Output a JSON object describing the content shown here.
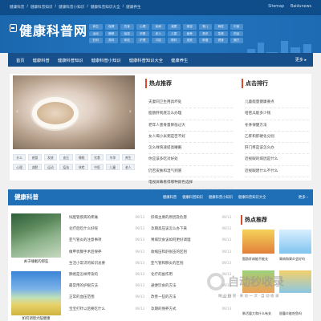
{
  "topbar": {
    "crumbs": [
      "健康科普",
      "健康科普知识",
      "健康科普小知识",
      "健康科普知识大全",
      "健康养生"
    ],
    "links": [
      "Sitemap",
      "Baidunews"
    ]
  },
  "site": {
    "logo_text": "健康科普网",
    "tags": [
      "养生",
      "保健",
      "饮食",
      "心理",
      "疾病",
      "减肥",
      "美容",
      "育儿",
      "两性",
      "中医",
      "运动",
      "睡眠",
      "疫苗",
      "孕婴",
      "老人",
      "儿童",
      "营养",
      "常识",
      "急救",
      "药品",
      "妇科",
      "男科",
      "体检",
      "护理",
      "口腔",
      "眼科",
      "皮肤",
      "肿瘤",
      "健身",
      "偏方"
    ]
  },
  "nav": {
    "items": [
      "首页",
      "健康科普",
      "健康科普知识",
      "健康科普小知识",
      "健康科普知识大全",
      "健康养生"
    ],
    "more": "更多 ▸"
  },
  "featured": {
    "tags": [
      "什么",
      "感冒",
      "发烧",
      "血压",
      "睡眠",
      "饮食",
      "冬季",
      "养生",
      "心理",
      "减肥",
      "运动",
      "疫苗",
      "体检",
      "中医",
      "儿童",
      "老人"
    ]
  },
  "hot": {
    "title": "热点推荐",
    "items": [
      "夫妻同卫生用具坏处",
      "脂肪肝到底怎么办理",
      "老年人患骨量降低过大",
      "女人喝小米粥是否不好",
      "怎么样快速提高睡眠",
      "你应该多吃对好处",
      "仍否皮肤和湿气到底",
      "电视屏幕看得哪种颜色选择"
    ]
  },
  "rank": {
    "title": "点击排行",
    "items": [
      "儿童能量健康要点",
      "哈密瓜能多少钱",
      "冬季保健方法",
      "乙肝和肝硬化分别",
      "肝门疼是该怎么办",
      "近视眼的病因是什么",
      "近视眼建什么不什么"
    ]
  },
  "health": {
    "title": "健康科普",
    "links": [
      "健康科普",
      "健康科普知识",
      "健康科普小知识",
      "健康科普知识大全"
    ],
    "more": "更多 ›",
    "thumb1_caption": "关于睡眠的那些",
    "thumb2_caption": "如何调理大脑健康",
    "col1": [
      {
        "t": "饲胆管疾病的疼痛",
        "d": "09/13"
      },
      {
        "t": "化疗后吃什么好呢",
        "d": "09/13"
      },
      {
        "t": "亚气管炎的注意事项",
        "d": "09/13"
      },
      {
        "t": "做甲状腺手术后保养",
        "d": "09/13"
      },
      {
        "t": "生活小常识的知识总要",
        "d": "09/13"
      },
      {
        "t": "肺癌是怎样传染的",
        "d": "09/13"
      },
      {
        "t": "最常用的护眼方法",
        "d": "09/13"
      },
      {
        "t": "正常的血压范围",
        "d": "09/13"
      },
      {
        "t": "宝宝打针以后要吃什么",
        "d": "09/13"
      }
    ],
    "col2": [
      {
        "t": "肝病主要的原因及危害",
        "d": "09/13"
      },
      {
        "t": "孕期高压该怎么办下来",
        "d": "09/13"
      },
      {
        "t": "胃病饮食该如何更好调理",
        "d": "09/13"
      },
      {
        "t": "收缩压和舒张压的区别",
        "d": "09/13"
      },
      {
        "t": "亚气管和肺炎的区别",
        "d": "09/13"
      },
      {
        "t": "化疗的副作用",
        "d": "09/13"
      },
      {
        "t": "通便饮食的方法",
        "d": "09/13"
      },
      {
        "t": "改善一些的方法",
        "d": "09/13"
      },
      {
        "t": "孕期的保养方式",
        "d": "09/13"
      }
    ]
  },
  "hot2": {
    "title": "热点推荐",
    "captions": [
      "脂肪肝病能不能长",
      "胃病和胃炎会好吗",
      "肺活量大和什么有关",
      "胆囊炎能吃鱼吗"
    ]
  },
  "watermark": {
    "big": "自动秒收录",
    "small": "做 上 链 接 · 来 访 一 次 · 自 动 收 录"
  }
}
